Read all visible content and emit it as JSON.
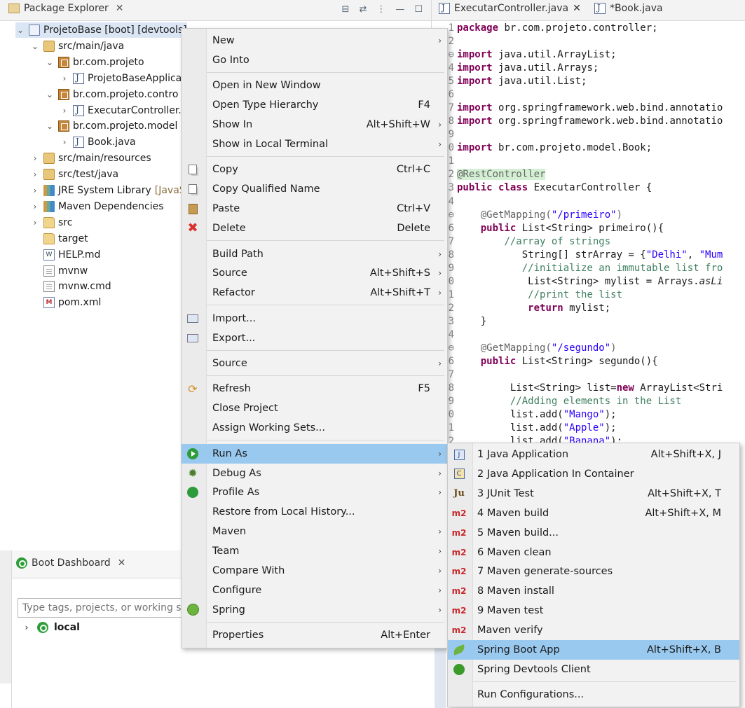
{
  "explorer": {
    "tab_label": "Package Explorer",
    "tree": [
      {
        "label": "ProjetoBase [boot] [devtools]",
        "chev": "v",
        "icon": "project-icon",
        "level": 0
      },
      {
        "label": "src/main/java",
        "chev": "v",
        "icon": "source-folder-icon",
        "level": 1
      },
      {
        "label": "br.com.projeto",
        "chev": "v",
        "icon": "package-icon",
        "level": 2
      },
      {
        "label": "ProjetoBaseApplica",
        "chev": ">",
        "icon": "java-file-icon",
        "level": 3
      },
      {
        "label": "br.com.projeto.contro",
        "chev": "v",
        "icon": "package-icon",
        "level": 2
      },
      {
        "label": "ExecutarController.",
        "chev": ">",
        "icon": "java-file-icon",
        "level": 3
      },
      {
        "label": "br.com.projeto.model",
        "chev": "v",
        "icon": "package-icon",
        "level": 2
      },
      {
        "label": "Book.java",
        "chev": ">",
        "icon": "java-file-icon",
        "level": 3
      },
      {
        "label": "src/main/resources",
        "chev": ">",
        "icon": "source-folder-icon",
        "level": 1
      },
      {
        "label": "src/test/java",
        "chev": ">",
        "icon": "source-folder-icon",
        "level": 1
      },
      {
        "label": "JRE System Library",
        "suffix": "[JavaSE",
        "chev": ">",
        "icon": "library-icon",
        "level": 1
      },
      {
        "label": "Maven Dependencies",
        "chev": ">",
        "icon": "library-icon",
        "level": 1
      },
      {
        "label": "src",
        "chev": ">",
        "icon": "folder-icon",
        "level": 1
      },
      {
        "label": "target",
        "chev": "",
        "icon": "folder-icon",
        "level": 1
      },
      {
        "label": "HELP.md",
        "chev": "",
        "icon": "markdown-file-icon",
        "level": 1
      },
      {
        "label": "mvnw",
        "chev": "",
        "icon": "file-icon",
        "level": 1
      },
      {
        "label": "mvnw.cmd",
        "chev": "",
        "icon": "file-icon",
        "level": 1
      },
      {
        "label": "pom.xml",
        "chev": "",
        "icon": "pom-file-icon",
        "level": 1
      }
    ]
  },
  "boot": {
    "tab_label": "Boot Dashboard",
    "search_placeholder": "Type tags, projects, or working set",
    "local_label": "local"
  },
  "editor": {
    "tabs": [
      {
        "label": "ExecutarController.java",
        "closable": true
      },
      {
        "label": "*Book.java",
        "closable": false
      }
    ],
    "lines": [
      {
        "n": "1",
        "html": "<span class='kw'>package</span> br.com.projeto.controller;"
      },
      {
        "n": "2",
        "html": ""
      },
      {
        "n": "3⊖",
        "html": "<span class='kw'>import</span> java.util.ArrayList;"
      },
      {
        "n": "4",
        "html": "<span class='kw'>import</span> java.util.Arrays;"
      },
      {
        "n": "5",
        "html": "<span class='kw'>import</span> java.util.List;"
      },
      {
        "n": "6",
        "html": ""
      },
      {
        "n": "7",
        "html": "<span class='kw'>import</span> org.springframework.web.bind.annotatio"
      },
      {
        "n": "8",
        "html": "<span class='kw'>import</span> org.springframework.web.bind.annotatio"
      },
      {
        "n": "9",
        "html": ""
      },
      {
        "n": "0",
        "html": "<span class='kw'>import</span> br.com.projeto.model.Book;"
      },
      {
        "n": "1",
        "html": ""
      },
      {
        "n": "2",
        "html": "<span class='an-hl'>@RestController</span>"
      },
      {
        "n": "3",
        "html": "<span class='kw'>public class</span> ExecutarController {"
      },
      {
        "n": "4",
        "html": ""
      },
      {
        "n": "5⊖",
        "html": "    <span class='an'>@GetMapping(</span><span class='st'>\"/primeiro\"</span><span class='an'>)</span>"
      },
      {
        "n": "6",
        "html": "    <span class='kw'>public</span> List&lt;String&gt; primeiro(){"
      },
      {
        "n": "7",
        "html": "        <span class='cm'>//array of strings</span>"
      },
      {
        "n": "8",
        "html": "           String[] strArray = {<span class='st'>\"Delhi\"</span>, <span class='st'>\"Mum</span>"
      },
      {
        "n": "9",
        "html": "           <span class='cm'>//initialize an immutable list fro</span>"
      },
      {
        "n": "0",
        "html": "            List&lt;String&gt; mylist = Arrays.<i>asLi</i>"
      },
      {
        "n": "1",
        "html": "            <span class='cm'>//print the list</span>"
      },
      {
        "n": "2",
        "html": "            <span class='kw'>return</span> mylist;"
      },
      {
        "n": "3",
        "html": "    }"
      },
      {
        "n": "4",
        "html": ""
      },
      {
        "n": "5⊖",
        "html": "    <span class='an'>@GetMapping(</span><span class='st'>\"/segundo\"</span><span class='an'>)</span>"
      },
      {
        "n": "6",
        "html": "    <span class='kw'>public</span> List&lt;String&gt; segundo(){"
      },
      {
        "n": "7",
        "html": ""
      },
      {
        "n": "8",
        "html": "         List&lt;String&gt; list=<span class='kw'>new</span> ArrayList&lt;Stri"
      },
      {
        "n": "9",
        "html": "         <span class='cm'>//Adding elements in the List</span>"
      },
      {
        "n": "0",
        "html": "         list.add(<span class='st'>\"Mango\"</span>);"
      },
      {
        "n": "1",
        "html": "         list.add(<span class='st'>\"Apple\"</span>);"
      },
      {
        "n": "2",
        "html": "         list.add(<span class='st'>\"Banana\"</span>);"
      }
    ]
  },
  "context_menu": {
    "items": [
      {
        "label": "New",
        "arrow": true
      },
      {
        "label": "Go Into"
      },
      {
        "sep": true
      },
      {
        "label": "Open in New Window"
      },
      {
        "label": "Open Type Hierarchy",
        "accel": "F4"
      },
      {
        "label": "Show In",
        "accel": "Alt+Shift+W",
        "arrow": true
      },
      {
        "label": "Show in Local Terminal",
        "arrow": true
      },
      {
        "sep": true
      },
      {
        "label": "Copy",
        "accel": "Ctrl+C",
        "icon": "copy-icon"
      },
      {
        "label": "Copy Qualified Name",
        "icon": "copy-qualified-icon"
      },
      {
        "label": "Paste",
        "accel": "Ctrl+V",
        "icon": "paste-icon"
      },
      {
        "label": "Delete",
        "accel": "Delete",
        "icon": "delete-icon"
      },
      {
        "sep": true
      },
      {
        "label": "Build Path",
        "arrow": true
      },
      {
        "label": "Source",
        "accel": "Alt+Shift+S",
        "arrow": true
      },
      {
        "label": "Refactor",
        "accel": "Alt+Shift+T",
        "arrow": true
      },
      {
        "sep": true
      },
      {
        "label": "Import...",
        "icon": "import-icon"
      },
      {
        "label": "Export...",
        "icon": "export-icon"
      },
      {
        "sep": true
      },
      {
        "label": "Source",
        "arrow": true
      },
      {
        "sep": true
      },
      {
        "label": "Refresh",
        "accel": "F5",
        "icon": "refresh-icon"
      },
      {
        "label": "Close Project"
      },
      {
        "label": "Assign Working Sets..."
      },
      {
        "sep": true
      },
      {
        "label": "Run As",
        "arrow": true,
        "icon": "run-icon",
        "highlighted": true
      },
      {
        "label": "Debug As",
        "arrow": true,
        "icon": "debug-icon"
      },
      {
        "label": "Profile As",
        "arrow": true,
        "icon": "profile-icon"
      },
      {
        "label": "Restore from Local History..."
      },
      {
        "label": "Maven",
        "arrow": true
      },
      {
        "label": "Team",
        "arrow": true
      },
      {
        "label": "Compare With",
        "arrow": true
      },
      {
        "label": "Configure",
        "arrow": true
      },
      {
        "label": "Spring",
        "arrow": true,
        "icon": "spring-icon"
      },
      {
        "sep": true
      },
      {
        "label": "Properties",
        "accel": "Alt+Enter"
      }
    ]
  },
  "run_as_menu": {
    "items": [
      {
        "label": "1 Java Application",
        "accel": "Alt+Shift+X, J",
        "icon": "java-app-icon"
      },
      {
        "label": "2 Java Application In Container",
        "icon": "java-container-icon"
      },
      {
        "label": "3 JUnit Test",
        "accel": "Alt+Shift+X, T",
        "icon": "junit-icon"
      },
      {
        "label": "4 Maven build",
        "accel": "Alt+Shift+X, M",
        "icon": "maven-icon"
      },
      {
        "label": "5 Maven build...",
        "icon": "maven-icon"
      },
      {
        "label": "6 Maven clean",
        "icon": "maven-icon"
      },
      {
        "label": "7 Maven generate-sources",
        "icon": "maven-icon"
      },
      {
        "label": "8 Maven install",
        "icon": "maven-icon"
      },
      {
        "label": "9 Maven test",
        "icon": "maven-icon"
      },
      {
        "label": "Maven verify",
        "icon": "maven-icon"
      },
      {
        "label": "Spring Boot App",
        "accel": "Alt+Shift+X, B",
        "icon": "spring-boot-icon",
        "highlighted": true
      },
      {
        "label": "Spring Devtools Client",
        "icon": "spring-devtools-icon"
      },
      {
        "sep": true
      },
      {
        "label": "Run Configurations..."
      }
    ]
  }
}
